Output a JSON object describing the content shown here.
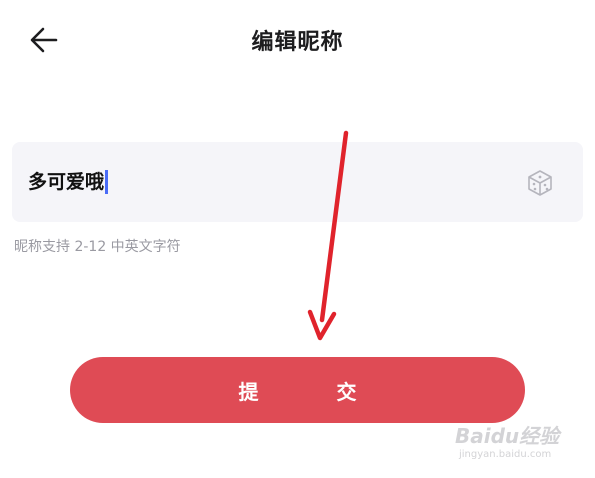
{
  "header": {
    "title": "编辑昵称",
    "back_icon": "arrow-left-icon"
  },
  "nickname": {
    "value": "多可爱哦",
    "random_icon": "dice-icon",
    "hint": "昵称支持 2-12 中英文字符"
  },
  "submit": {
    "char1": "提",
    "char2": "交",
    "color": "#df4b55"
  },
  "annotation": {
    "arrow_color": "#e0232c"
  },
  "watermark": {
    "brand": "Baidu经验",
    "url": "jingyan.baidu.com"
  }
}
